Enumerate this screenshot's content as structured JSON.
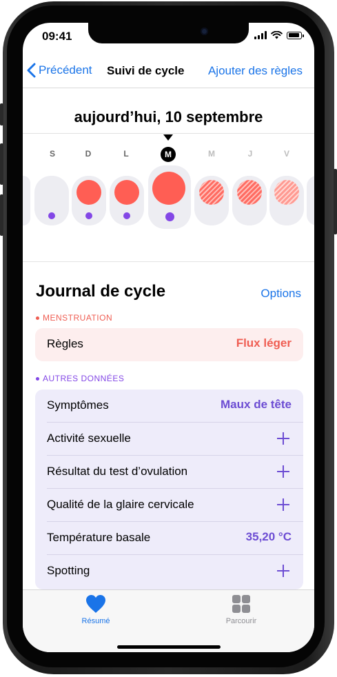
{
  "status_bar": {
    "time": "09:41"
  },
  "nav": {
    "back_label": "Précédent",
    "title": "Suivi de cycle",
    "right_action": "Ajouter des règles"
  },
  "calendar": {
    "date_title": "aujourd’hui, 10 septembre",
    "days": [
      "S",
      "D",
      "L",
      "M",
      "M",
      "J",
      "V"
    ],
    "today_label": "M"
  },
  "journal": {
    "title": "Journal de cycle",
    "options_label": "Options",
    "menstruation_caption": "MENSTRUATION",
    "period_label": "Règles",
    "period_value": "Flux léger",
    "other_caption": "AUTRES DONNÉES",
    "rows": [
      {
        "label": "Symptômes",
        "value": "Maux de tête"
      },
      {
        "label": "Activité sexuelle"
      },
      {
        "label": "Résultat du test d’ovulation"
      },
      {
        "label": "Qualité de la glaire cervicale"
      },
      {
        "label": "Température basale",
        "value": "35,20 °C"
      },
      {
        "label": "Spotting"
      }
    ]
  },
  "tabbar": {
    "summary_label": "Résumé",
    "browse_label": "Parcourir"
  },
  "colors": {
    "accent_blue": "#1a74e8",
    "period_red": "#ff5e54",
    "purple": "#8347e6",
    "purple_text": "#6c4cd3",
    "flow_text": "#ef5d52"
  },
  "icons": [
    "chevron-left-icon",
    "heart-icon",
    "grid-icon",
    "signal-icon",
    "wifi-icon",
    "battery-icon",
    "plus-icon"
  ]
}
